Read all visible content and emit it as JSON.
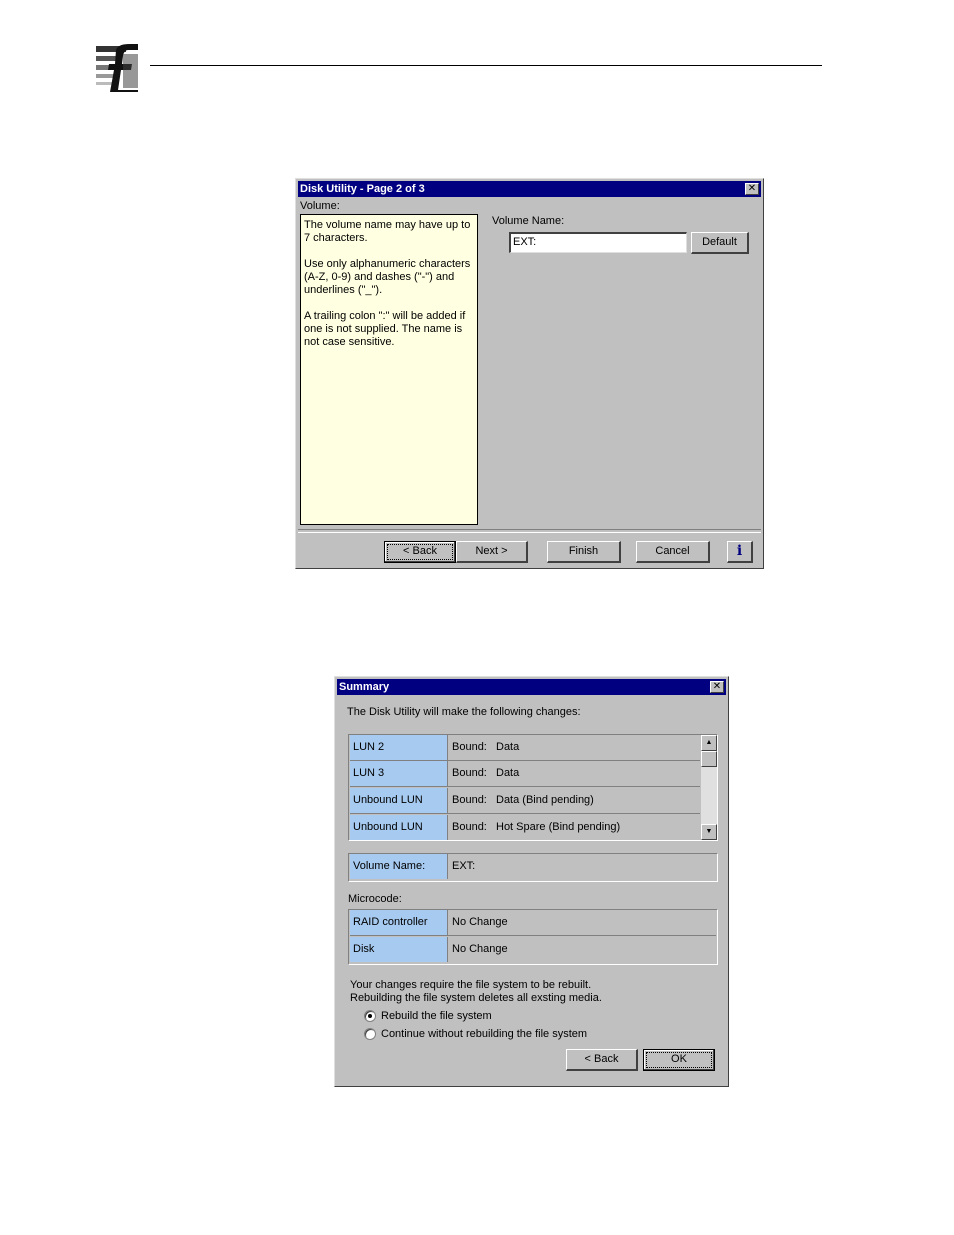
{
  "dialog1": {
    "title": "Disk Utility - Page 2 of 3",
    "close_glyph": "✕",
    "volume_label": "Volume:",
    "help_paragraphs": [
      "The volume name may have up to 7 characters.",
      "Use only alphanumeric characters (A-Z, 0-9) and dashes (\"-\") and underlines (\"_\").",
      "A trailing colon \":\" will be added if one is not supplied.  The name is not case sensitive."
    ],
    "volume_name_label": "Volume Name:",
    "volume_name_value": "EXT:",
    "default_button": "Default",
    "buttons": {
      "back": "< Back",
      "next": "Next >",
      "finish": "Finish",
      "cancel": "Cancel",
      "info": "i"
    }
  },
  "dialog2": {
    "title": "Summary",
    "close_glyph": "✕",
    "intro": "The Disk Utility will make the following changes:",
    "lun_rows": [
      {
        "name": "LUN 2",
        "status": "Bound:",
        "value": "Data"
      },
      {
        "name": "LUN 3",
        "status": "Bound:",
        "value": "Data"
      },
      {
        "name": "Unbound LUN",
        "status": "Bound:",
        "value": "Data (Bind pending)"
      },
      {
        "name": "Unbound LUN",
        "status": "Bound:",
        "value": "Hot Spare (Bind pending)"
      }
    ],
    "scroll_up": "▲",
    "scroll_down": "▼",
    "volume_row": {
      "name": "Volume Name:",
      "value": "EXT:"
    },
    "microcode_label": "Microcode:",
    "microcode_rows": [
      {
        "name": "RAID controller",
        "value": "No Change"
      },
      {
        "name": "Disk",
        "value": "No Change"
      }
    ],
    "notice_line1": "Your changes require the file system to be rebuilt.",
    "notice_line2": "Rebuilding the file system deletes all exsting media.",
    "radio_rebuild": "Rebuild the file system",
    "radio_continue": "Continue without rebuilding the file system",
    "selected_option": "Rebuild the file system",
    "buttons": {
      "back": "< Back",
      "ok": "OK"
    }
  }
}
